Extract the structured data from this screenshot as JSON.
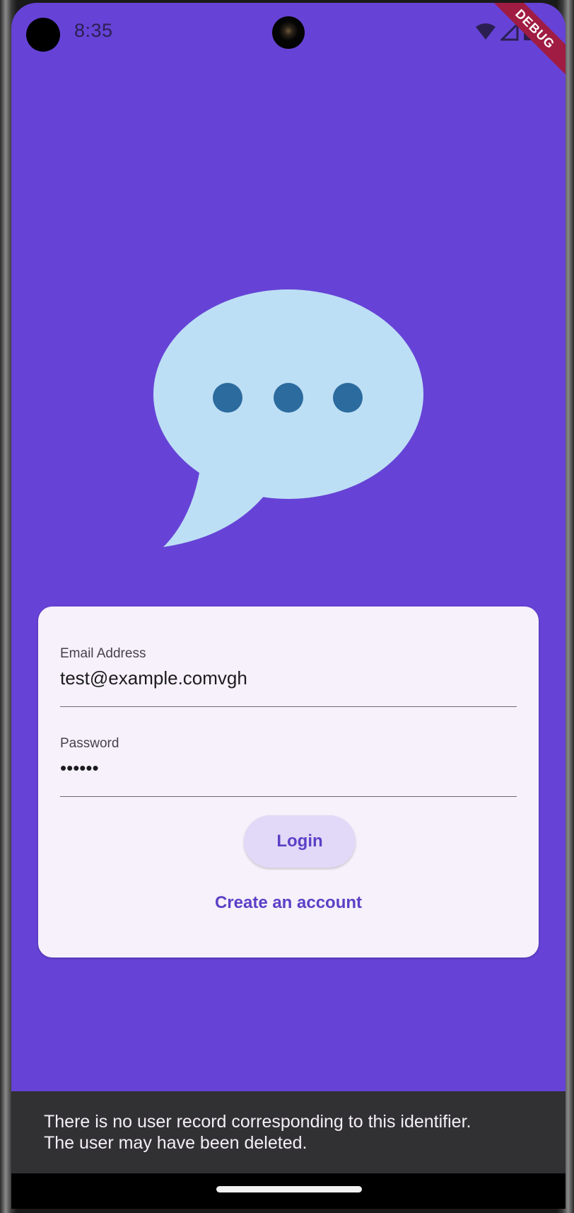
{
  "status_bar": {
    "time": "8:35",
    "debug_label": "DEBUG"
  },
  "login_form": {
    "email_label": "Email Address",
    "email_value": "test@example.comvgh",
    "password_label": "Password",
    "password_value": "••••••",
    "login_label": "Login",
    "create_account_label": "Create an account"
  },
  "snackbar": {
    "line1": "There is no user record corresponding to this identifier.",
    "line2": "The user may have been deleted."
  },
  "colors": {
    "background": "#6643d6",
    "card": "#f6f1fa",
    "accent": "#5d3fc6",
    "bubble": "#bddff5",
    "bubble_dots": "#2c6b9e",
    "snackbar": "#313033"
  },
  "icons": [
    "chat-bubble-icon",
    "wifi-icon",
    "signal-icon",
    "battery-icon"
  ]
}
